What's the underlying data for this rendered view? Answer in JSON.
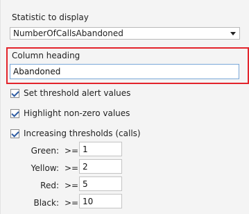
{
  "statistic": {
    "label": "Statistic to display",
    "selected": "NumberOfCallsAbandoned"
  },
  "column_heading": {
    "label": "Column heading",
    "value": "Abandoned"
  },
  "options": {
    "set_threshold": "Set threshold alert values",
    "highlight_nonzero": "Highlight non-zero values",
    "increasing_thresholds": "Increasing thresholds (calls)"
  },
  "thresholds": [
    {
      "label": "Green:",
      "op": ">=",
      "value": "1"
    },
    {
      "label": "Yellow:",
      "op": ">=",
      "value": "2"
    },
    {
      "label": "Red:",
      "op": ">=",
      "value": "5"
    },
    {
      "label": "Black:",
      "op": ">=",
      "value": "10"
    }
  ],
  "colors": {
    "highlight_border": "#e3242b",
    "checkmark": "#2c5aa0"
  }
}
